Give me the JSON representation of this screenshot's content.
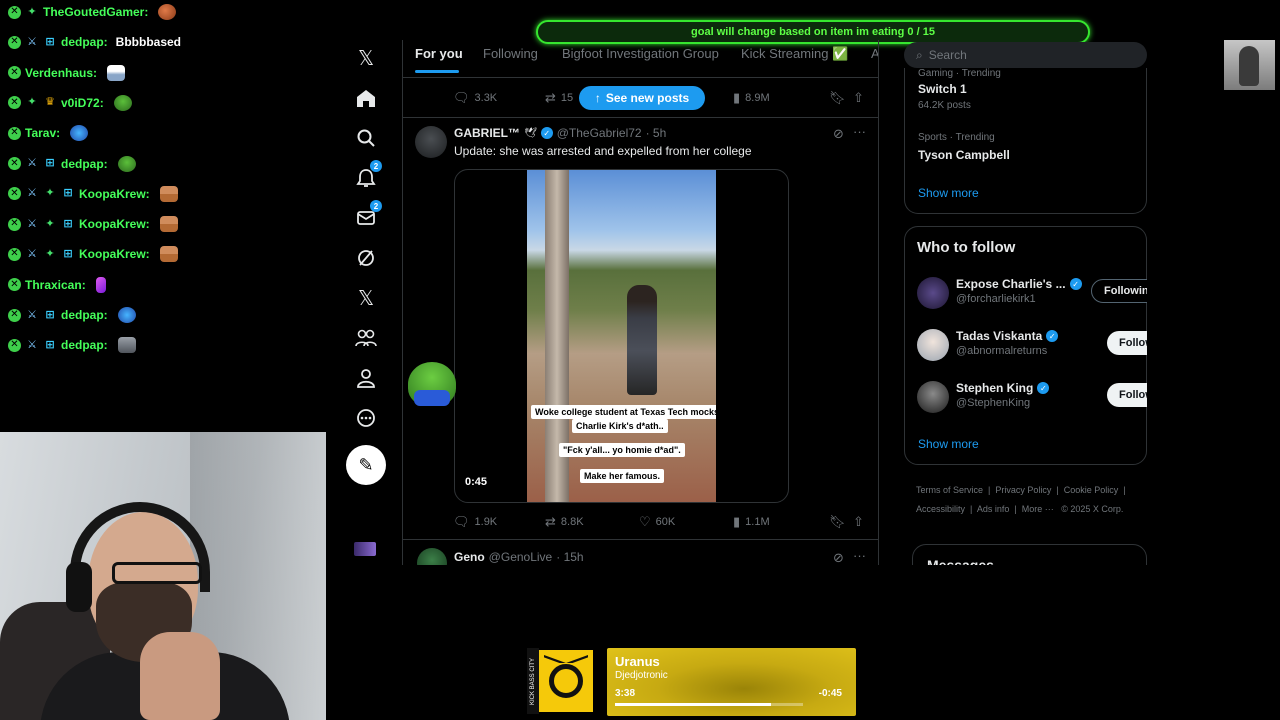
{
  "chat": [
    {
      "user": "TheGoutedGamer:",
      "message": "",
      "badges": [
        "mod",
        "star"
      ],
      "emote": "chicken"
    },
    {
      "user": "dedpap:",
      "message": "Bbbbbased",
      "badges": [
        "mod",
        "sword",
        "grid"
      ],
      "emote": ""
    },
    {
      "user": "Verdenhaus:",
      "message": "",
      "badges": [
        "mod"
      ],
      "emote": "ship"
    },
    {
      "user": "v0iD72:",
      "message": "",
      "badges": [
        "mod",
        "star",
        "crown"
      ],
      "emote": "frog"
    },
    {
      "user": "Tarav:",
      "message": "",
      "badges": [
        "mod"
      ],
      "emote": "planet"
    },
    {
      "user": "dedpap:",
      "message": "",
      "badges": [
        "mod",
        "sword",
        "grid"
      ],
      "emote": "frog"
    },
    {
      "user": "KoopaKrew:",
      "message": "",
      "badges": [
        "mod",
        "sword",
        "star",
        "grid"
      ],
      "emote": "man"
    },
    {
      "user": "KoopaKrew:",
      "message": "",
      "badges": [
        "mod",
        "sword",
        "star",
        "grid"
      ],
      "emote": "man"
    },
    {
      "user": "KoopaKrew:",
      "message": "",
      "badges": [
        "mod",
        "sword",
        "star",
        "grid"
      ],
      "emote": "man"
    },
    {
      "user": "Thraxican:",
      "message": "",
      "badges": [
        "mod"
      ],
      "emote": "feather"
    },
    {
      "user": "dedpap:",
      "message": "",
      "badges": [
        "mod",
        "sword",
        "grid"
      ],
      "emote": "planet"
    },
    {
      "user": "dedpap:",
      "message": "",
      "badges": [
        "mod",
        "sword",
        "grid"
      ],
      "emote": "dog"
    }
  ],
  "goal": {
    "text": "goal will change based on item im eating 0 / 15"
  },
  "nav": {
    "icons": [
      "x-logo-icon",
      "home-icon",
      "explore-icon",
      "notifications-icon",
      "messages-icon",
      "grok-icon",
      "premium-x-icon",
      "communities-icon",
      "profile-icon",
      "more-icon"
    ],
    "notifications_badge": "2",
    "messages_badge": "2"
  },
  "feed": {
    "tabs": [
      "For you",
      "Following",
      "Bigfoot Investigation Group",
      "Kick Streaming ✅",
      "A"
    ],
    "prev_actions": {
      "replies": "3.3K",
      "reposts": "15",
      "views": "8.9M"
    },
    "new_posts_label": "See new posts",
    "tweet": {
      "name": "GABRIEL™",
      "handle": "@TheGabriel72",
      "time": "· 5h",
      "text": "Update: she was arrested and expelled from her college",
      "captions": [
        "Woke college student at Texas Tech mocks",
        "Charlie Kirk's d*ath..",
        "\"Fck y'all... yo homie d*ad\".",
        "Make her famous."
      ],
      "duration": "0:45",
      "actions": {
        "replies": "1.9K",
        "reposts": "8.8K",
        "likes": "60K",
        "views": "1.1M"
      }
    },
    "next_tweet": {
      "name": "Geno",
      "handle": "@GenoLive",
      "time": "· 15h"
    }
  },
  "sidebar": {
    "search_placeholder": "Search",
    "trends": [
      {
        "category": "Gaming · Trending",
        "name": "Switch 1",
        "count": "64.2K posts"
      },
      {
        "category": "Sports · Trending",
        "name": "Tyson Campbell",
        "count": ""
      }
    ],
    "show_more": "Show more",
    "who_to_follow": {
      "title": "Who to follow",
      "accounts": [
        {
          "name": "Expose Charlie's ...",
          "handle": "@forcharliekirk1",
          "button": "Following"
        },
        {
          "name": "Tadas Viskanta",
          "handle": "@abnormalreturns",
          "button": "Follow"
        },
        {
          "name": "Stephen King",
          "handle": "@StephenKing",
          "button": "Follow"
        }
      ],
      "show_more": "Show more"
    },
    "footer": [
      "Terms of Service",
      "Privacy Policy",
      "Cookie Policy",
      "Accessibility",
      "Ads info",
      "More ···",
      "© 2025 X Corp."
    ],
    "messages_title": "Messages"
  },
  "player": {
    "title": "Uranus",
    "artist": "Djedjotronic",
    "elapsed": "3:38",
    "remaining": "-0:45",
    "progress": 0.83,
    "album_side_text": "KICK BASS CITY"
  },
  "colors": {
    "accent": "#1d9bf0",
    "goal_green": "#36e62f",
    "chat_user": "#45ff5a",
    "player_gold": "#e0c21a"
  }
}
